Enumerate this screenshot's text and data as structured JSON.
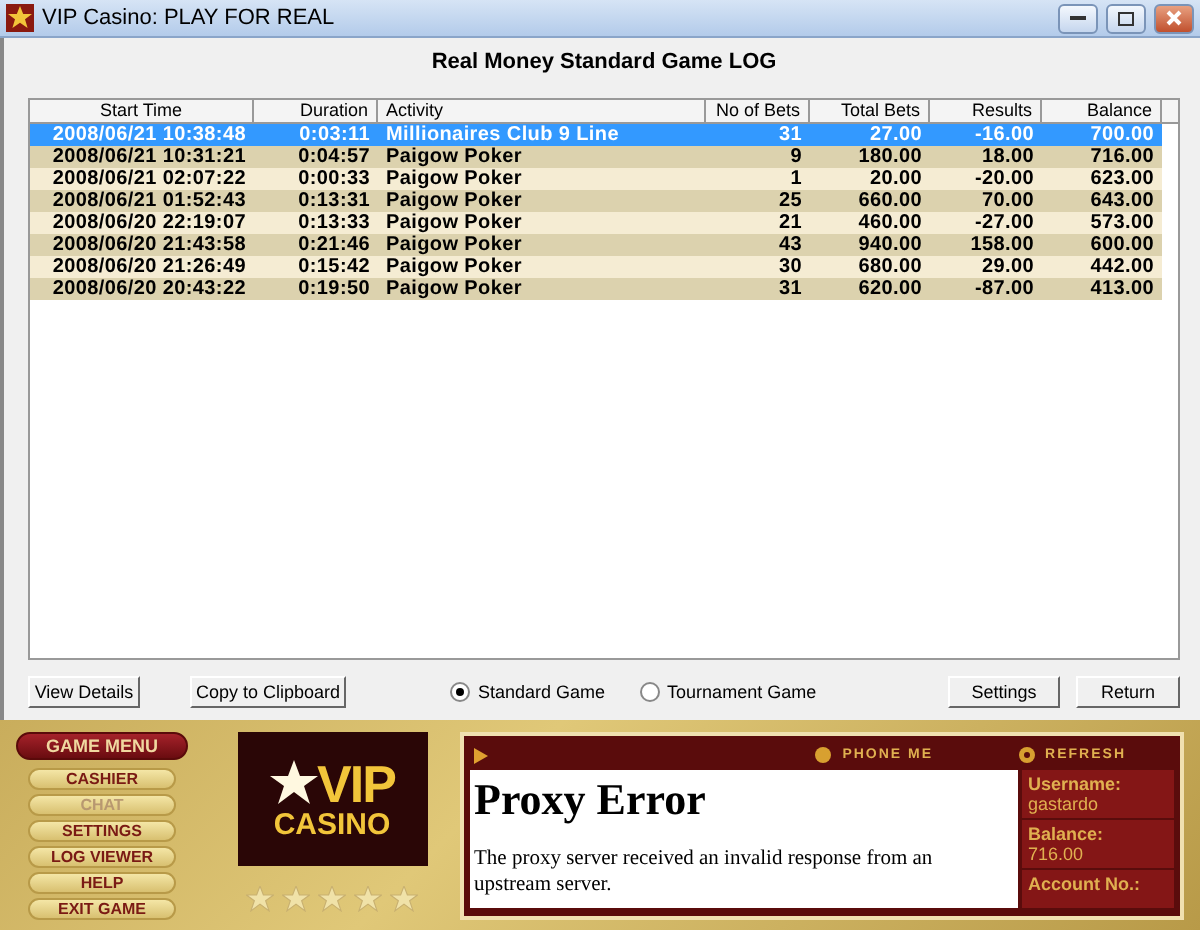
{
  "window": {
    "title": "VIP Casino: PLAY FOR REAL"
  },
  "heading": "Real Money Standard Game LOG",
  "table": {
    "columns": [
      "Start Time",
      "Duration",
      "Activity",
      "No of Bets",
      "Total Bets",
      "Results",
      "Balance"
    ],
    "rows": [
      {
        "selected": true,
        "cells": [
          "2008/06/21 10:38:48",
          "0:03:11",
          "Millionaires Club 9 Line",
          "31",
          "27.00",
          "-16.00",
          "700.00"
        ]
      },
      {
        "selected": false,
        "cells": [
          "2008/06/21 10:31:21",
          "0:04:57",
          "Paigow Poker",
          "9",
          "180.00",
          "18.00",
          "716.00"
        ]
      },
      {
        "selected": false,
        "cells": [
          "2008/06/21 02:07:22",
          "0:00:33",
          "Paigow Poker",
          "1",
          "20.00",
          "-20.00",
          "623.00"
        ]
      },
      {
        "selected": false,
        "cells": [
          "2008/06/21 01:52:43",
          "0:13:31",
          "Paigow Poker",
          "25",
          "660.00",
          "70.00",
          "643.00"
        ]
      },
      {
        "selected": false,
        "cells": [
          "2008/06/20 22:19:07",
          "0:13:33",
          "Paigow Poker",
          "21",
          "460.00",
          "-27.00",
          "573.00"
        ]
      },
      {
        "selected": false,
        "cells": [
          "2008/06/20 21:43:58",
          "0:21:46",
          "Paigow Poker",
          "43",
          "940.00",
          "158.00",
          "600.00"
        ]
      },
      {
        "selected": false,
        "cells": [
          "2008/06/20 21:26:49",
          "0:15:42",
          "Paigow Poker",
          "30",
          "680.00",
          "29.00",
          "442.00"
        ]
      },
      {
        "selected": false,
        "cells": [
          "2008/06/20 20:43:22",
          "0:19:50",
          "Paigow Poker",
          "31",
          "620.00",
          "-87.00",
          "413.00"
        ]
      }
    ]
  },
  "left_buttons": [
    "View Details",
    "Copy to Clipboard"
  ],
  "game_types": [
    {
      "label": "Standard Game",
      "selected": true
    },
    {
      "label": "Tournament Game",
      "selected": false
    }
  ],
  "right_buttons": [
    "Settings",
    "Return"
  ],
  "game_menu": {
    "title": "GAME MENU",
    "items": [
      {
        "label": "CASHIER",
        "disabled": false
      },
      {
        "label": "CHAT",
        "disabled": true
      },
      {
        "label": "SETTINGS",
        "disabled": false
      },
      {
        "label": "LOG VIEWER",
        "disabled": false
      },
      {
        "label": "HELP",
        "disabled": false
      },
      {
        "label": "EXIT GAME",
        "disabled": false
      }
    ]
  },
  "logo": {
    "line_1": "VIP",
    "line_2": "CASINO"
  },
  "stars": 5,
  "toolbar": [
    "PHONE ME",
    "REFRESH"
  ],
  "browser": {
    "title": "Proxy Error",
    "message": "The proxy server received an invalid response from an upstream server."
  },
  "account": [
    {
      "label": "Username:",
      "value": "gastardo"
    },
    {
      "label": "Balance:",
      "value": "716.00"
    },
    {
      "label": "Account No.:"
    }
  ]
}
